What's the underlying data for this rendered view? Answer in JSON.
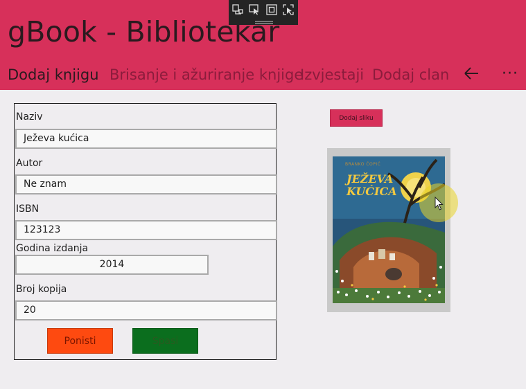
{
  "app": {
    "title": "gBook - Bibliotekar"
  },
  "nav": {
    "items": [
      {
        "label": "Dodaj knjigu",
        "active": true
      },
      {
        "label": "Brisanje i ažuriranje knjige",
        "active": false
      },
      {
        "label": "Izvjestaji",
        "active": false
      },
      {
        "label": "Dodaj clana",
        "active": false
      }
    ],
    "back_icon": "arrow-left-icon",
    "more_label": "···"
  },
  "debug_toolbar": {
    "icons": [
      "live-visual-tree-icon",
      "select-element-icon",
      "display-layout-adorners-icon",
      "track-focus-icon"
    ]
  },
  "form": {
    "fields": [
      {
        "label": "Naziv",
        "value": "Ježeva kućica"
      },
      {
        "label": "Autor",
        "value": "Ne znam"
      },
      {
        "label": "ISBN",
        "value": "123123"
      },
      {
        "label": "Godina izdanja",
        "value": "2014"
      },
      {
        "label": "Broj kopija",
        "value": "20"
      }
    ],
    "reset_label": "Ponisti",
    "save_label": "Spasi"
  },
  "image": {
    "add_label": "Dodaj sliku",
    "cover_author": "BRANKO ĆOPIĆ",
    "cover_title_1": "JEŽEVA",
    "cover_title_2": "KUĆICA"
  },
  "colors": {
    "accent": "#d7305a",
    "background": "#efedf0",
    "reset_button": "#fe4a10",
    "save_button": "#0b6e1e"
  }
}
